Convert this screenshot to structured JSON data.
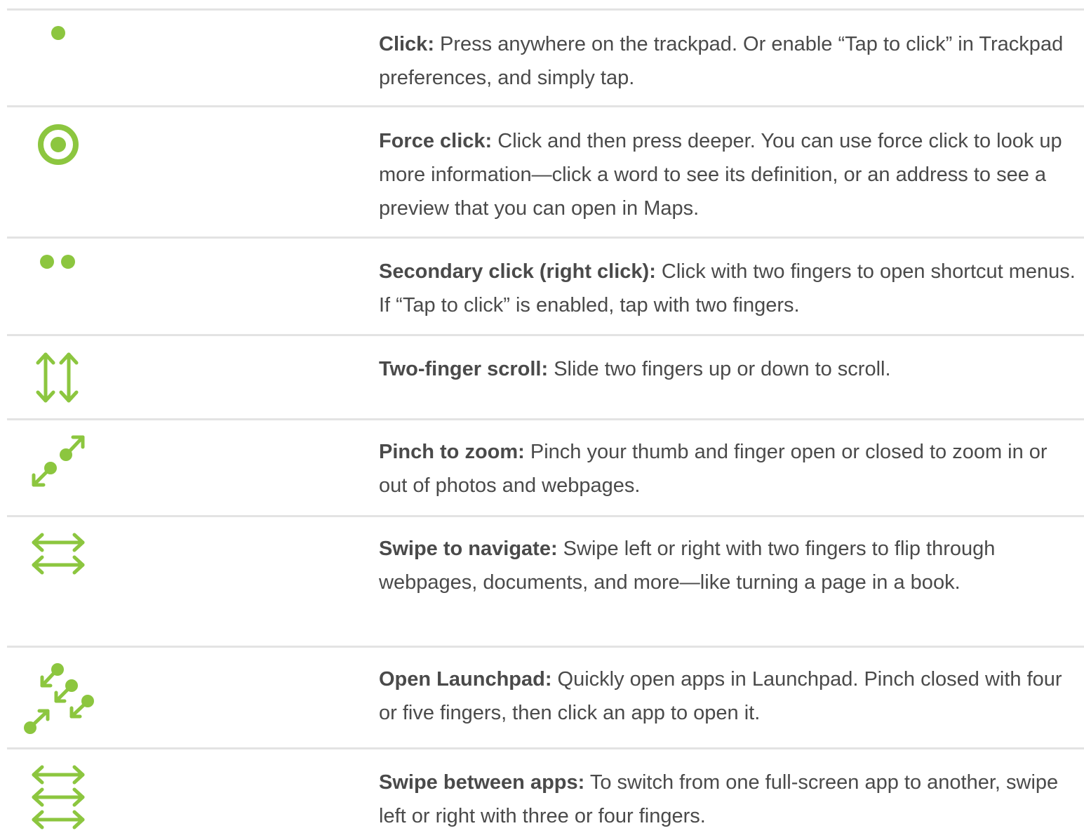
{
  "accent_color": "#8cc63f",
  "divider_color": "#e3e3e3",
  "text_color": "#4a4a4a",
  "gestures": [
    {
      "icon": "single-dot-icon",
      "term": "Click:",
      "text": " Press anywhere on the trackpad. Or enable “Tap to click” in Trackpad preferences, and simply tap."
    },
    {
      "icon": "target-icon",
      "term": "Force click:",
      "text": " Click and then press deeper. You can use force click to look up more information—click a word to see its definition, or an address to see a preview that you can open in Maps."
    },
    {
      "icon": "two-dots-icon",
      "term": "Secondary click (right click):",
      "text": " Click with two fingers to open shortcut menus. If “Tap to click” is enabled, tap with two fingers."
    },
    {
      "icon": "vertical-double-arrow-icon",
      "term": "Two-finger scroll:",
      "text": " Slide two fingers up or down to scroll."
    },
    {
      "icon": "pinch-zoom-icon",
      "term": "Pinch to zoom:",
      "text": " Pinch your thumb and finger open or closed to zoom in or out of photos and webpages."
    },
    {
      "icon": "two-horizontal-arrows-icon",
      "term": "Swipe to navigate:",
      "text": " Swipe left or right with two fingers to flip through webpages, documents, and more—like turning a page in a book."
    },
    {
      "icon": "launchpad-pinch-icon",
      "term": "Open Launchpad:",
      "text": " Quickly open apps in Launchpad. Pinch closed with four or five fingers, then click an app to open it."
    },
    {
      "icon": "three-horizontal-arrows-icon",
      "term": "Swipe between apps:",
      "text": " To switch from one full-screen app to another, swipe left or right with three or four fingers."
    }
  ]
}
